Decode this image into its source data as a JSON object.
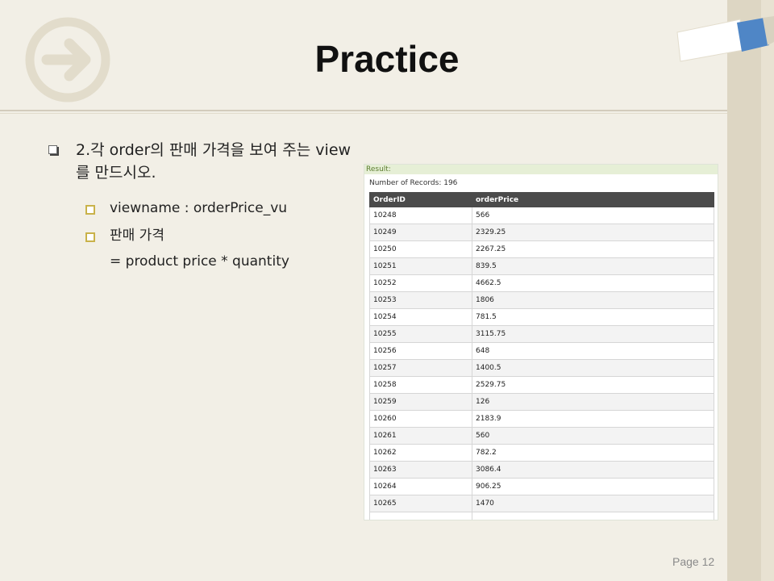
{
  "slide": {
    "title": "Practice",
    "page_label": "Page 12"
  },
  "content": {
    "item1": "2.각 order의 판매 가격을 보여 주는 view를 만드시오.",
    "sub1": "viewname : orderPrice_vu",
    "sub2": "판매 가격",
    "sub2_cont": "= product price * quantity"
  },
  "result": {
    "header": "Result:",
    "records": "Number of Records: 196",
    "columns": [
      "OrderID",
      "orderPrice"
    ],
    "rows": [
      [
        "10248",
        "566"
      ],
      [
        "10249",
        "2329.25"
      ],
      [
        "10250",
        "2267.25"
      ],
      [
        "10251",
        "839.5"
      ],
      [
        "10252",
        "4662.5"
      ],
      [
        "10253",
        "1806"
      ],
      [
        "10254",
        "781.5"
      ],
      [
        "10255",
        "3115.75"
      ],
      [
        "10256",
        "648"
      ],
      [
        "10257",
        "1400.5"
      ],
      [
        "10258",
        "2529.75"
      ],
      [
        "10259",
        "126"
      ],
      [
        "10260",
        "2183.9"
      ],
      [
        "10261",
        "560"
      ],
      [
        "10262",
        "782.2"
      ],
      [
        "10263",
        "3086.4"
      ],
      [
        "10264",
        "906.25"
      ],
      [
        "10265",
        "1470"
      ],
      [
        "",
        ""
      ]
    ]
  },
  "icons": {
    "left": "arrow-right-circle-icon",
    "right": "tab-decoration-icon"
  },
  "colors": {
    "background": "#f2efe6",
    "band": "#ddd6c3",
    "accent_blue": "#4f86c6",
    "table_header": "#4b4b4b",
    "result_header": "#e6efd6"
  }
}
